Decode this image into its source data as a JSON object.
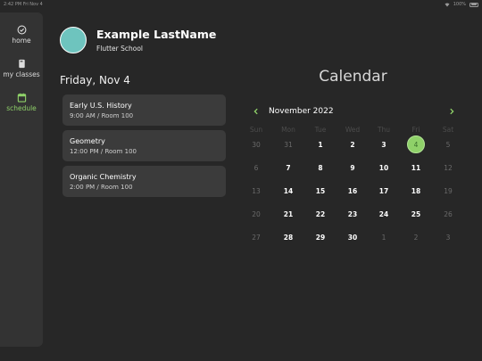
{
  "status_bar": {
    "time": "2:42 PM",
    "date": "Fri Nov 4",
    "battery": "100%"
  },
  "sidebar": {
    "items": [
      {
        "label": "home",
        "icon": "check-circle-icon",
        "active": false
      },
      {
        "label": "my classes",
        "icon": "book-icon",
        "active": false
      },
      {
        "label": "schedule",
        "icon": "calendar-icon",
        "active": true
      }
    ]
  },
  "profile": {
    "name": "Example LastName",
    "school": "Flutter School",
    "avatar_color": "#6ec4be"
  },
  "schedule": {
    "day_heading": "Friday, Nov 4",
    "classes": [
      {
        "title": "Early U.S. History",
        "meta": "9:00 AM / Room 100"
      },
      {
        "title": "Geometry",
        "meta": "12:00 PM / Room 100"
      },
      {
        "title": "Organic Chemistry",
        "meta": "2:00 PM / Room 100"
      }
    ]
  },
  "calendar": {
    "title": "Calendar",
    "month_label": "November 2022",
    "weekdays": [
      "Sun",
      "Mon",
      "Tue",
      "Wed",
      "Thu",
      "Fri",
      "Sat"
    ],
    "selected_day": "4",
    "accent_color": "#8fd169",
    "weeks": [
      [
        "30",
        "31",
        "1",
        "2",
        "3",
        "4",
        "5"
      ],
      [
        "6",
        "7",
        "8",
        "9",
        "10",
        "11",
        "12"
      ],
      [
        "13",
        "14",
        "15",
        "16",
        "17",
        "18",
        "19"
      ],
      [
        "20",
        "21",
        "22",
        "23",
        "24",
        "25",
        "26"
      ],
      [
        "27",
        "28",
        "29",
        "30",
        "1",
        "2",
        "3"
      ]
    ],
    "in_month": [
      [
        false,
        false,
        true,
        true,
        true,
        true,
        false
      ],
      [
        false,
        true,
        true,
        true,
        true,
        true,
        false
      ],
      [
        false,
        true,
        true,
        true,
        true,
        true,
        false
      ],
      [
        false,
        true,
        true,
        true,
        true,
        true,
        false
      ],
      [
        false,
        true,
        true,
        true,
        false,
        false,
        false
      ]
    ]
  }
}
